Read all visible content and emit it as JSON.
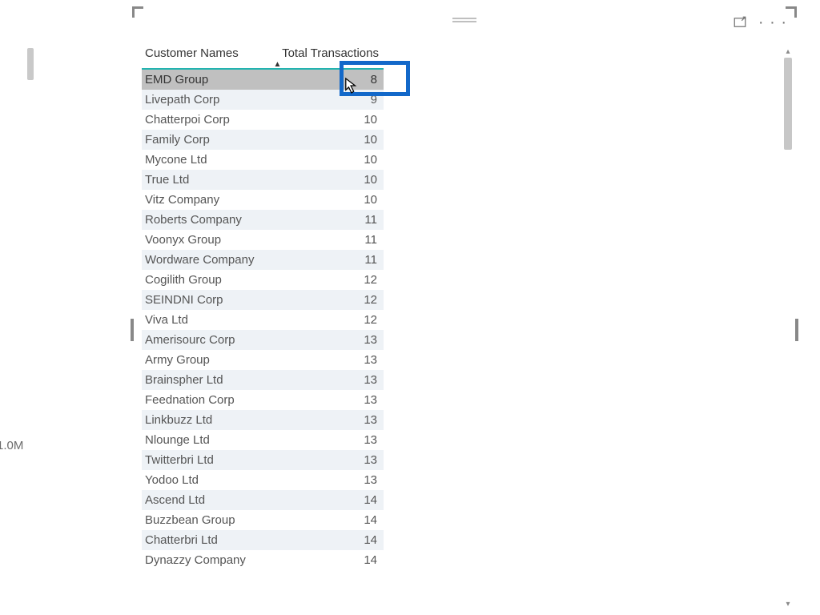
{
  "left_axis_label": "1.0M",
  "table": {
    "headers": {
      "customer": "Customer Names",
      "transactions": "Total Transactions"
    },
    "rows": [
      {
        "name": "EMD Group",
        "value": "8",
        "selected": true
      },
      {
        "name": "Livepath Corp",
        "value": "9",
        "alt": true
      },
      {
        "name": "Chatterpoi Corp",
        "value": "10"
      },
      {
        "name": "Family Corp",
        "value": "10",
        "alt": true
      },
      {
        "name": "Mycone Ltd",
        "value": "10"
      },
      {
        "name": "True Ltd",
        "value": "10",
        "alt": true
      },
      {
        "name": "Vitz Company",
        "value": "10"
      },
      {
        "name": "Roberts Company",
        "value": "11",
        "alt": true
      },
      {
        "name": "Voonyx Group",
        "value": "11"
      },
      {
        "name": "Wordware Company",
        "value": "11",
        "alt": true
      },
      {
        "name": "Cogilith Group",
        "value": "12"
      },
      {
        "name": "SEINDNI Corp",
        "value": "12",
        "alt": true
      },
      {
        "name": "Viva Ltd",
        "value": "12"
      },
      {
        "name": "Amerisourc Corp",
        "value": "13",
        "alt": true
      },
      {
        "name": "Army Group",
        "value": "13"
      },
      {
        "name": "Brainspher Ltd",
        "value": "13",
        "alt": true
      },
      {
        "name": "Feednation Corp",
        "value": "13"
      },
      {
        "name": "Linkbuzz Ltd",
        "value": "13",
        "alt": true
      },
      {
        "name": "Nlounge Ltd",
        "value": "13"
      },
      {
        "name": "Twitterbri Ltd",
        "value": "13",
        "alt": true
      },
      {
        "name": "Yodoo Ltd",
        "value": "13"
      },
      {
        "name": "Ascend Ltd",
        "value": "14",
        "alt": true
      },
      {
        "name": "Buzzbean Group",
        "value": "14"
      },
      {
        "name": "Chatterbri Ltd",
        "value": "14",
        "alt": true
      },
      {
        "name": "Dynazzy Company",
        "value": "14"
      }
    ]
  },
  "icons": {
    "focus": "focus-mode-icon",
    "more": "more-options-icon"
  }
}
